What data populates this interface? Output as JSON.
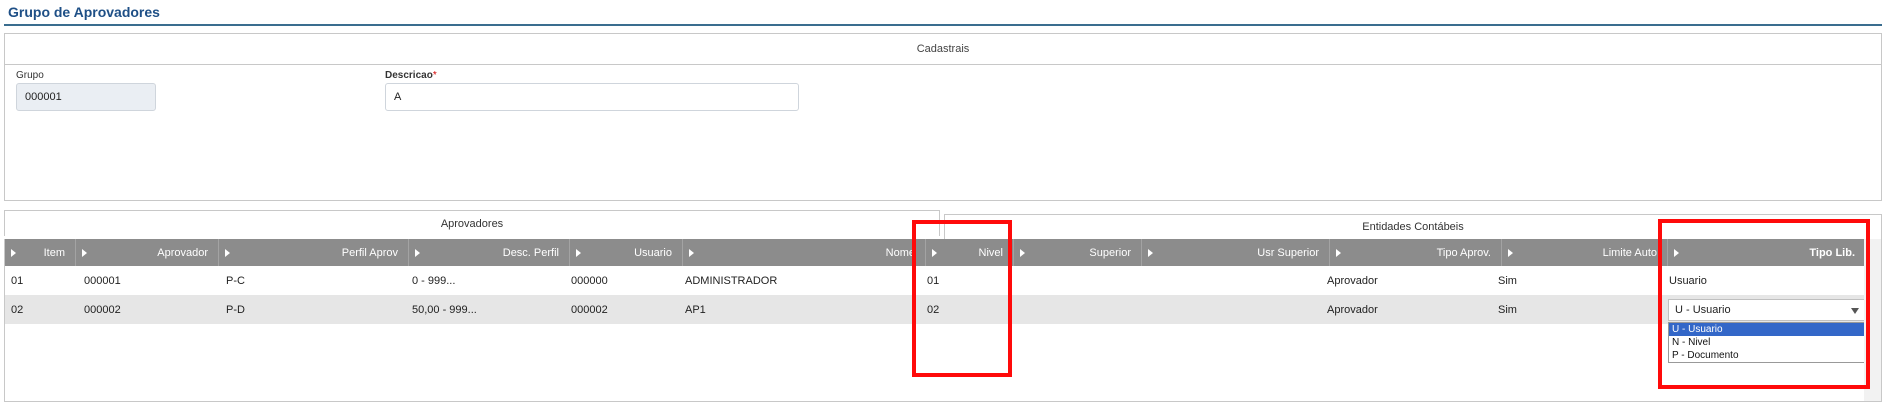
{
  "page": {
    "title": "Grupo de Aprovadores"
  },
  "cadastrais": {
    "header": "Cadastrais",
    "grupo": {
      "label": "Grupo",
      "value": "000001"
    },
    "descricao": {
      "label": "Descricao",
      "required_mark": "*",
      "value": "A"
    }
  },
  "tabs": {
    "aprovadores": "Aprovadores",
    "entidades": "Entidades Contábeis"
  },
  "grid": {
    "columns": [
      "Item",
      "Aprovador",
      "Perfil Aprov",
      "Desc. Perfil",
      "Usuario",
      "Nome",
      "Nivel",
      "Superior",
      "Usr Superior",
      "Tipo Aprov.",
      "Limite Auto",
      "Tipo Lib."
    ],
    "rows": [
      {
        "item": "01",
        "aprovador": "000001",
        "perfil": "P-C",
        "desc": "0 - 999...",
        "usuario": "000000",
        "nome": "ADMINISTRADOR",
        "nivel": "01",
        "superior": "",
        "usr_superior": "",
        "tipo_aprov": "Aprovador",
        "limite": "Sim",
        "tipo_lib": "Usuario"
      },
      {
        "item": "02",
        "aprovador": "000002",
        "perfil": "P-D",
        "desc": "50,00 - 999...",
        "usuario": "000002",
        "nome": "AP1",
        "nivel": "02",
        "superior": "",
        "usr_superior": "",
        "tipo_aprov": "Aprovador",
        "limite": "Sim",
        "tipo_lib": "U - Usuario"
      }
    ]
  },
  "tipo_lib_options": [
    "U - Usuario",
    "N - Nivel",
    "P - Documento"
  ],
  "highlight_color": "#ff0a0a"
}
